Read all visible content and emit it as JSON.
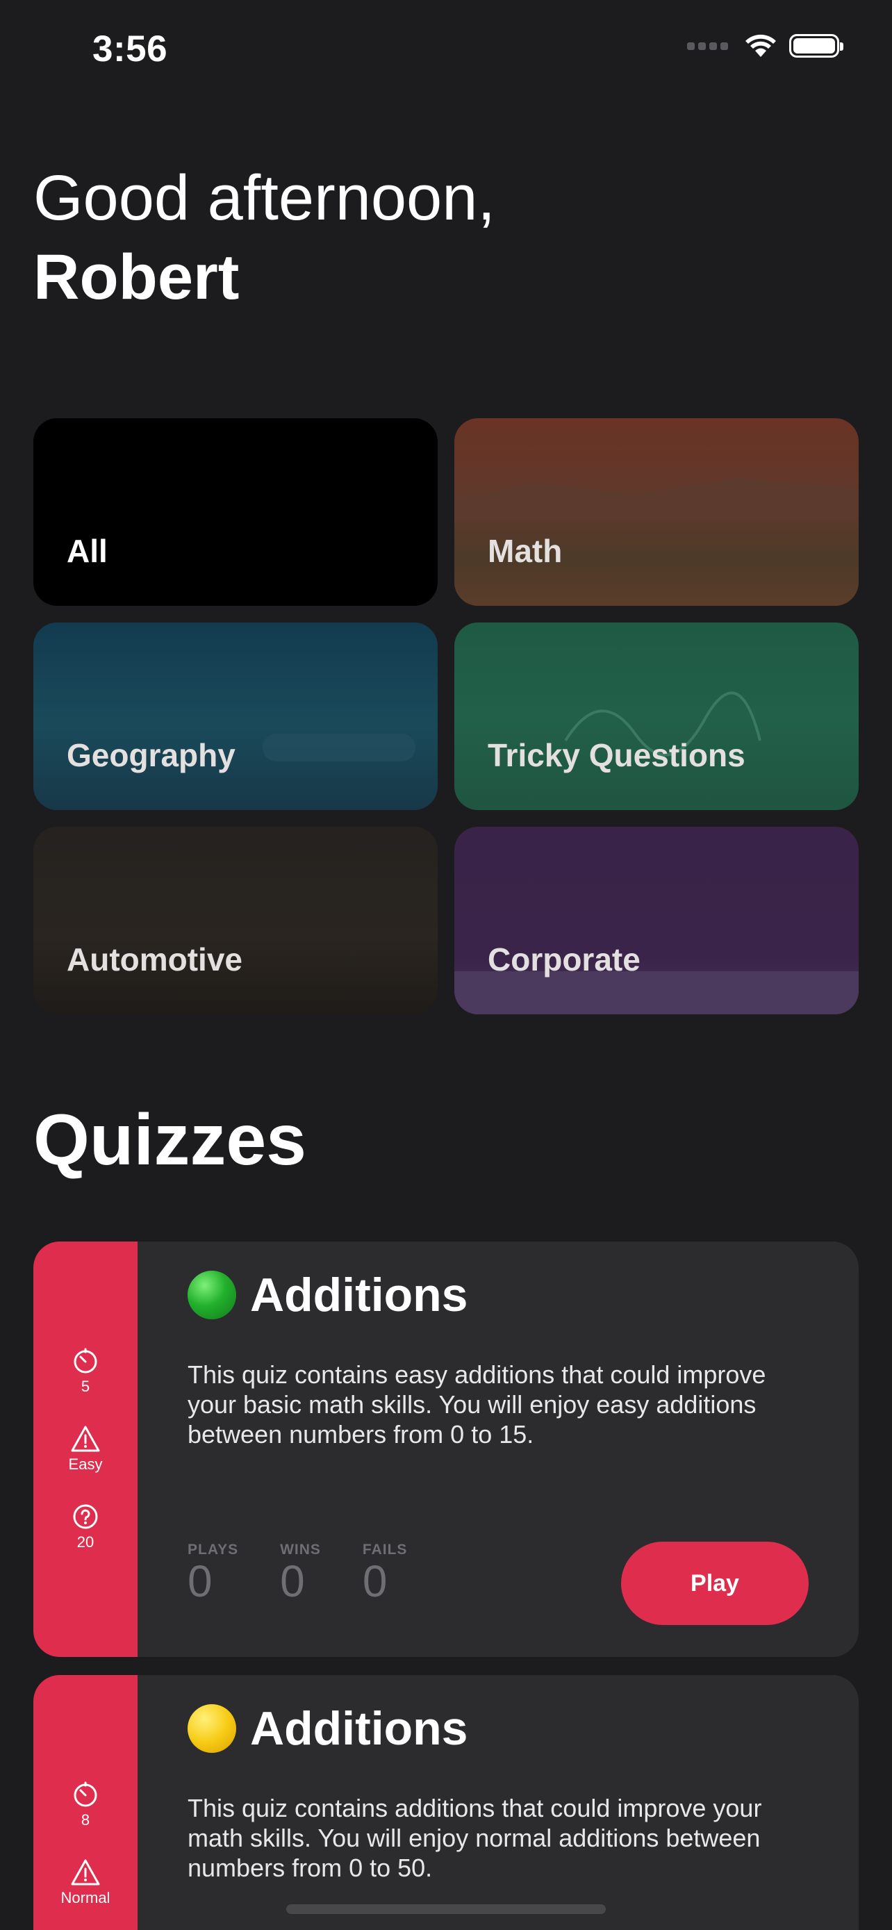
{
  "status_bar": {
    "time": "3:56",
    "icons": [
      "cellular-signal-icon",
      "wifi-icon",
      "battery-icon"
    ]
  },
  "greeting": {
    "line1": "Good afternoon,",
    "name": "Robert"
  },
  "categories": [
    {
      "label": "All"
    },
    {
      "label": "Math"
    },
    {
      "label": "Geography"
    },
    {
      "label": "Tricky Questions"
    },
    {
      "label": "Automotive"
    },
    {
      "label": "Corporate"
    }
  ],
  "quizzes_section": {
    "title": "Quizzes"
  },
  "quizzes": [
    {
      "difficulty_icon": "green-circle",
      "title": "Additions",
      "description": "This quiz contains easy additions that could improve your basic math skills. You will enjoy easy additions between numbers from 0 to 15.",
      "time": "5",
      "difficulty": "Easy",
      "questions": "20",
      "stats": {
        "plays_label": "PLAYS",
        "plays": "0",
        "wins_label": "WINS",
        "wins": "0",
        "fails_label": "FAILS",
        "fails": "0"
      },
      "play_label": "Play"
    },
    {
      "difficulty_icon": "yellow-circle",
      "title": "Additions",
      "description": "This quiz contains additions that could improve your math skills. You will enjoy normal additions between numbers from 0 to 50.",
      "time": "8",
      "difficulty": "Normal"
    }
  ],
  "colors": {
    "background": "#1c1c1e",
    "card": "#2c2c2e",
    "accent": "#de2d4d",
    "muted_text": "#6e6e73"
  }
}
